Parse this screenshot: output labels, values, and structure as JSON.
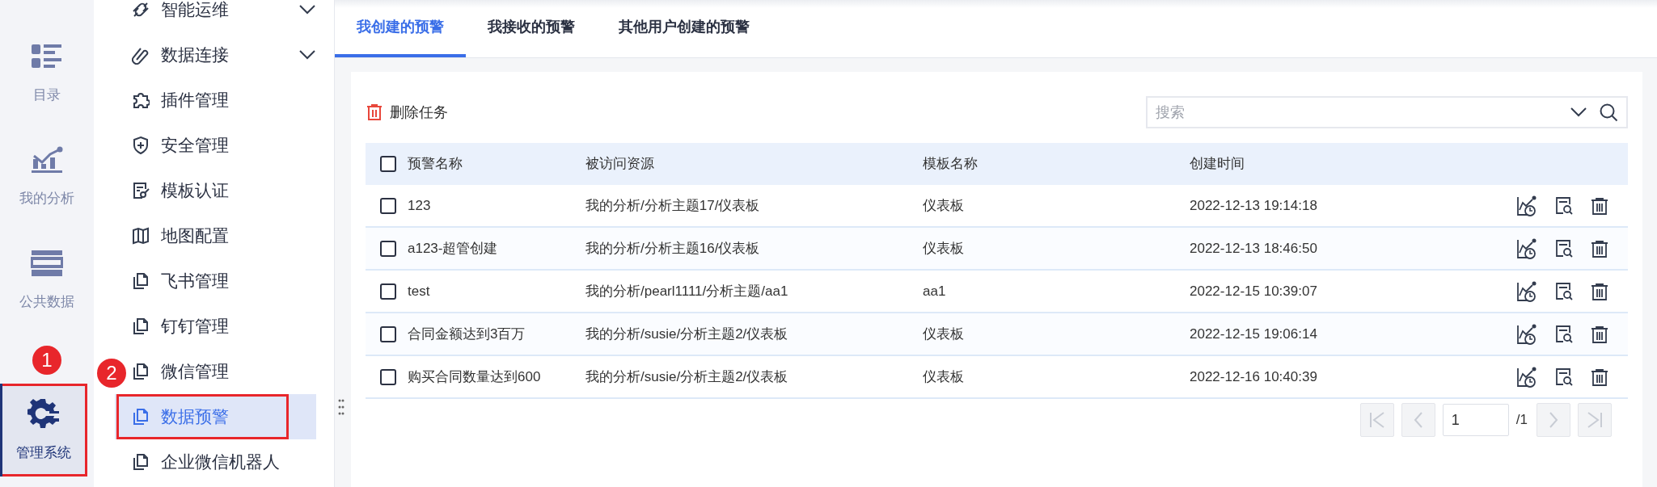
{
  "rail": [
    {
      "label": "目录",
      "selected": false
    },
    {
      "label": "我的分析",
      "selected": false
    },
    {
      "label": "公共数据",
      "selected": false
    },
    {
      "label": "管理系统",
      "selected": true
    }
  ],
  "nav": [
    {
      "label": "智能运维",
      "expandable": true,
      "selected": false
    },
    {
      "label": "数据连接",
      "expandable": true,
      "selected": false
    },
    {
      "label": "插件管理",
      "expandable": false,
      "selected": false
    },
    {
      "label": "安全管理",
      "expandable": false,
      "selected": false
    },
    {
      "label": "模板认证",
      "expandable": false,
      "selected": false
    },
    {
      "label": "地图配置",
      "expandable": false,
      "selected": false
    },
    {
      "label": "飞书管理",
      "expandable": false,
      "selected": false
    },
    {
      "label": "钉钉管理",
      "expandable": false,
      "selected": false
    },
    {
      "label": "微信管理",
      "expandable": false,
      "selected": false
    },
    {
      "label": "数据预警",
      "expandable": false,
      "selected": true
    },
    {
      "label": "企业微信机器人",
      "expandable": false,
      "selected": false
    }
  ],
  "annotations": [
    "1",
    "2"
  ],
  "tabs": [
    {
      "label": "我创建的预警",
      "selected": true
    },
    {
      "label": "我接收的预警",
      "selected": false
    },
    {
      "label": "其他用户创建的预警",
      "selected": false
    }
  ],
  "delete_button": "删除任务",
  "search": {
    "placeholder": "搜索"
  },
  "table": {
    "select_all_checked": false,
    "columns": [
      "预警名称",
      "被访问资源",
      "模板名称",
      "创建时间"
    ],
    "rows": [
      {
        "checked": false,
        "cells": [
          "123",
          "我的分析/分析主题17/仪表板",
          "仪表板",
          "2022-12-13 19:14:18"
        ]
      },
      {
        "checked": false,
        "cells": [
          "a123-超管创建",
          "我的分析/分析主题16/仪表板",
          "仪表板",
          "2022-12-13 18:46:50"
        ]
      },
      {
        "checked": false,
        "cells": [
          "test",
          "我的分析/pearl1111/分析主题/aa1",
          "aa1",
          "2022-12-15 10:39:07"
        ]
      },
      {
        "checked": false,
        "cells": [
          "合同金额达到3百万",
          "我的分析/susie/分析主题2/仪表板",
          "仪表板",
          "2022-12-15 19:06:14"
        ]
      },
      {
        "checked": false,
        "cells": [
          "购买合同数量达到600",
          "我的分析/susie/分析主题2/仪表板",
          "仪表板",
          "2022-12-16 10:40:39"
        ]
      }
    ]
  },
  "pagination": {
    "page": "1",
    "total": "/1"
  }
}
